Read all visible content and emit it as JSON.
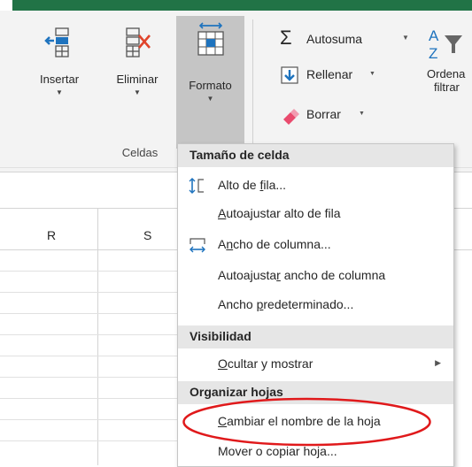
{
  "ribbon": {
    "buttons": [
      {
        "id": "insertar",
        "label": "Insertar",
        "has_dropdown": true
      },
      {
        "id": "eliminar",
        "label": "Eliminar",
        "has_dropdown": true
      },
      {
        "id": "formato",
        "label": "Formato",
        "has_dropdown": true,
        "active": true
      }
    ],
    "group_label": "Celdas",
    "editing": [
      {
        "id": "autosuma",
        "label": "Autosuma",
        "icon": "sigma-icon"
      },
      {
        "id": "rellenar",
        "label": "Rellenar",
        "icon": "fill-down-icon"
      },
      {
        "id": "borrar",
        "label": "Borrar",
        "icon": "eraser-icon"
      }
    ],
    "sort_filter": {
      "line1": "Ordena",
      "line2": "filtrar"
    }
  },
  "columns": [
    "R",
    "S"
  ],
  "menu": {
    "sections": [
      {
        "header": "Tamaño de celda"
      },
      {
        "header": "Visibilidad"
      },
      {
        "header": "Organizar hojas"
      }
    ],
    "items": {
      "alto_fila": {
        "before": "Alto de ",
        "u": "f",
        "after": "ila..."
      },
      "autoajustar_alto": {
        "before": "",
        "u": "A",
        "after": "utoajustar alto de fila"
      },
      "ancho_columna": {
        "before": "A",
        "u": "n",
        "after": "cho de columna..."
      },
      "autoajustar_ancho": {
        "before": "Autoajusta",
        "u": "r",
        "after": " ancho de columna"
      },
      "ancho_predeterminado": {
        "before": "Ancho ",
        "u": "p",
        "after": "redeterminado..."
      },
      "ocultar_mostrar": {
        "before": "",
        "u": "O",
        "after": "cultar y mostrar"
      },
      "cambiar_nombre": {
        "before": "",
        "u": "C",
        "after": "ambiar el nombre de la hoja"
      },
      "mover_copiar": {
        "before": "Mover o copiar hoja..."
      }
    }
  },
  "colors": {
    "excel_green": "#217346",
    "highlight_oval": "#e0191b",
    "pressed": "#c5c5c5"
  }
}
